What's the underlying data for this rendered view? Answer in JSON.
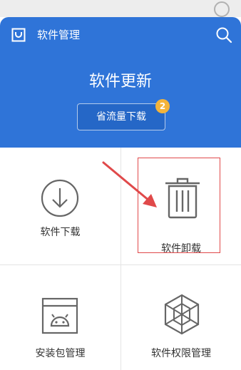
{
  "header": {
    "app_title": "软件管理",
    "update_title": "软件更新",
    "save_button_label": "省流量下载",
    "badge_count": "2"
  },
  "grid": {
    "items": [
      {
        "label": "软件下载",
        "icon": "download-circle-icon"
      },
      {
        "label": "软件卸载",
        "icon": "trash-icon"
      },
      {
        "label": "安装包管理",
        "icon": "android-package-icon"
      },
      {
        "label": "软件权限管理",
        "icon": "hexagon-permission-icon"
      }
    ]
  },
  "colors": {
    "header_bg": "#2f74d8",
    "badge": "#f4b43a",
    "annotation": "#e0494a",
    "icon_gray": "#666666"
  }
}
